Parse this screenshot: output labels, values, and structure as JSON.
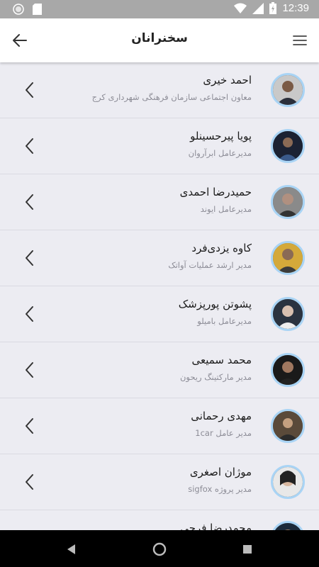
{
  "status_bar": {
    "time": "12:39",
    "icons": [
      "cast-icon",
      "sd-card-icon",
      "wifi-icon",
      "cellular-signal-icon",
      "battery-charging-icon"
    ]
  },
  "app_bar": {
    "title": "سخنرانان",
    "back_icon": "arrow-left-icon",
    "menu_icon": "hamburger-menu-icon"
  },
  "speakers": [
    {
      "name": "احمد خیری",
      "role": "معاون اجتماعی سازمان فرهنگی شهرداری کرج"
    },
    {
      "name": "پویا پیرحسینلو",
      "role": "مدیرعامل ابرآروان"
    },
    {
      "name": "حمیدرضا احمدی",
      "role": "مدیرعامل ایوند"
    },
    {
      "name": "کاوه یزدی‌فرد",
      "role": "مدیر ارشد عملیات آواتک"
    },
    {
      "name": "پشوتن پورپزشک",
      "role": "مدیرعامل بامیلو"
    },
    {
      "name": "محمد سمیعی",
      "role": "مدیر مارکتینگ ریحون"
    },
    {
      "name": "مهدی رحمانی",
      "role": "مدیر عامل 1car"
    },
    {
      "name": "موژان اصغری",
      "role": "مدیر پروژه sigfox"
    },
    {
      "name": "محمدرضا فرجی",
      "role": ""
    }
  ],
  "colors": {
    "list_background": "#ececf2",
    "avatar_ring": "#a9d4f5",
    "status_bar": "#a8a8a8",
    "nav_bar": "#000000"
  },
  "nav_bar": {
    "icons": [
      "back-triangle-icon",
      "home-circle-icon",
      "recents-square-icon"
    ]
  }
}
